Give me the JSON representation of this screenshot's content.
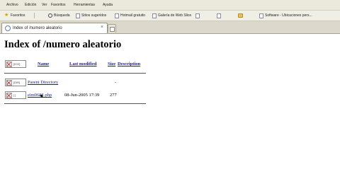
{
  "menu": [
    "Archivo",
    "Edición",
    "Ver",
    "Favoritos",
    "Herramientas",
    "Ayuda"
  ],
  "favorites": {
    "favorites_label": "Favoritos",
    "search_label": "Búsqueda",
    "links": [
      "Sitios sugeridos",
      "Hotmail gratuito",
      "Galería de Web Slice",
      "",
      "",
      "",
      "Software - Ubicaciones pers..."
    ]
  },
  "tab": {
    "title": "Index of /numero aleatorio"
  },
  "page": {
    "heading": "Index of /numero aleatorio",
    "columns": {
      "icon_alt": "[ICO]",
      "name": "Name",
      "last_modified": "Last modified",
      "size": "Size",
      "description": "Description"
    },
    "rows": [
      {
        "icon_alt": "[DIR]",
        "name": "Parent Directory",
        "last_modified": "",
        "size": "-"
      },
      {
        "icon_alt": "[ ]",
        "name": "eim0682.php",
        "last_modified": "08-Jun-2005 17:39",
        "size": "277"
      }
    ]
  }
}
